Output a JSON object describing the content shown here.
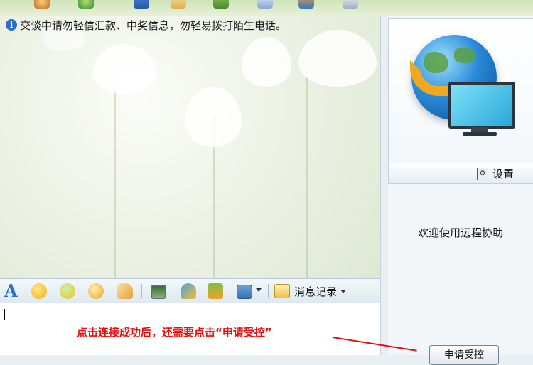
{
  "top_toolbar": {
    "icons": [
      "user-icon",
      "frog-icon",
      "mail-icon",
      "folder-icon",
      "app-icon",
      "document-icon",
      "chart-icon",
      "cloud-icon"
    ]
  },
  "chat": {
    "notice_icon": "info-icon",
    "notice_text": "交谈中请勿轻信汇款、中奖信息，勿轻易拨打陌生电话。"
  },
  "input_toolbar": {
    "font_label": "A",
    "icons": [
      "font-icon",
      "smiley-icon",
      "fun-face-icon",
      "wink-icon",
      "hand-icon",
      "image-icon",
      "user-add-icon",
      "gift-icon",
      "screenshot-icon"
    ],
    "message_log_label": "消息记录"
  },
  "input": {
    "annotation": "点击连接成功后，还需要点击“申请受控”",
    "annotation_color": "#e01010"
  },
  "side_panel": {
    "image_icon": "remote-assist-globe-icon",
    "settings_label": "设置",
    "welcome_text": "欢迎使用远程协助",
    "apply_button_label": "申请受控"
  },
  "colors": {
    "accent": "#2a6fc8",
    "annotation_red": "#e01010"
  }
}
